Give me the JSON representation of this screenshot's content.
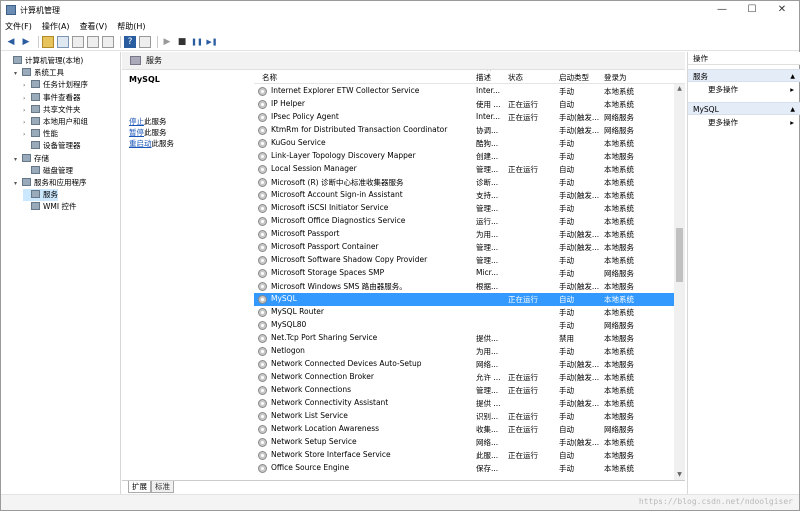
{
  "window": {
    "title": "计算机管理",
    "min": "—",
    "max": "☐",
    "close": "✕"
  },
  "menu": [
    "文件(F)",
    "操作(A)",
    "查看(V)",
    "帮助(H)"
  ],
  "toolbar": {
    "back": "◀",
    "fwd": "▶",
    "play": "▶",
    "stop": "■",
    "pause": "❚❚",
    "restart": "▶❚"
  },
  "tree": [
    {
      "label": "计算机管理(本地)",
      "level": 0,
      "arrow": "",
      "selected": false
    },
    {
      "label": "系统工具",
      "level": 1,
      "arrow": "▾",
      "selected": false
    },
    {
      "label": "任务计划程序",
      "level": 2,
      "arrow": "›",
      "selected": false
    },
    {
      "label": "事件查看器",
      "level": 2,
      "arrow": "›",
      "selected": false
    },
    {
      "label": "共享文件夹",
      "level": 2,
      "arrow": "›",
      "selected": false
    },
    {
      "label": "本地用户和组",
      "level": 2,
      "arrow": "›",
      "selected": false
    },
    {
      "label": "性能",
      "level": 2,
      "arrow": "›",
      "selected": false
    },
    {
      "label": "设备管理器",
      "level": 2,
      "arrow": "",
      "selected": false
    },
    {
      "label": "存储",
      "level": 1,
      "arrow": "▾",
      "selected": false
    },
    {
      "label": "磁盘管理",
      "level": 2,
      "arrow": "",
      "selected": false
    },
    {
      "label": "服务和应用程序",
      "level": 1,
      "arrow": "▾",
      "selected": false
    },
    {
      "label": "服务",
      "level": 2,
      "arrow": "",
      "selected": true
    },
    {
      "label": "WMI 控件",
      "level": 2,
      "arrow": "",
      "selected": false
    }
  ],
  "detail": {
    "header": "服务",
    "selected_service": "MySQL",
    "actions": [
      {
        "link": "停止",
        "rest": "此服务"
      },
      {
        "link": "暂停",
        "rest": "此服务"
      },
      {
        "link": "重启动",
        "rest": "此服务"
      }
    ]
  },
  "columns": [
    "名称",
    "描述",
    "状态",
    "启动类型",
    "登录为"
  ],
  "services": [
    [
      "Internet Explorer ETW Collector Service",
      "Inter...",
      "",
      "手动",
      "本地系统"
    ],
    [
      "IP Helper",
      "使用 ...",
      "正在运行",
      "自动",
      "本地系统"
    ],
    [
      "IPsec Policy Agent",
      "Inter...",
      "正在运行",
      "手动(触发...",
      "网络服务"
    ],
    [
      "KtmRm for Distributed Transaction Coordinator",
      "协调...",
      "",
      "手动(触发...",
      "网络服务"
    ],
    [
      "KuGou Service",
      "酷狗...",
      "",
      "手动",
      "本地系统"
    ],
    [
      "Link-Layer Topology Discovery Mapper",
      "创建...",
      "",
      "手动",
      "本地服务"
    ],
    [
      "Local Session Manager",
      "管理...",
      "正在运行",
      "自动",
      "本地系统"
    ],
    [
      "Microsoft (R) 诊断中心标准收集器服务",
      "诊断...",
      "",
      "手动",
      "本地系统"
    ],
    [
      "Microsoft Account Sign-in Assistant",
      "支持...",
      "",
      "手动(触发...",
      "本地系统"
    ],
    [
      "Microsoft iSCSI Initiator Service",
      "管理...",
      "",
      "手动",
      "本地系统"
    ],
    [
      "Microsoft Office Diagnostics Service",
      "运行...",
      "",
      "手动",
      "本地系统"
    ],
    [
      "Microsoft Passport",
      "为用...",
      "",
      "手动(触发...",
      "本地系统"
    ],
    [
      "Microsoft Passport Container",
      "管理...",
      "",
      "手动(触发...",
      "本地服务"
    ],
    [
      "Microsoft Software Shadow Copy Provider",
      "管理...",
      "",
      "手动",
      "本地系统"
    ],
    [
      "Microsoft Storage Spaces SMP",
      "Micr...",
      "",
      "手动",
      "网络服务"
    ],
    [
      "Microsoft Windows SMS 路由器服务。",
      "根据...",
      "",
      "手动(触发...",
      "本地服务"
    ],
    [
      "MySQL",
      "",
      "正在运行",
      "自动",
      "本地系统"
    ],
    [
      "MySQL Router",
      "",
      "",
      "手动",
      "本地系统"
    ],
    [
      "MySQL80",
      "",
      "",
      "手动",
      "网络服务"
    ],
    [
      "Net.Tcp Port Sharing Service",
      "提供...",
      "",
      "禁用",
      "本地服务"
    ],
    [
      "Netlogon",
      "为用...",
      "",
      "手动",
      "本地系统"
    ],
    [
      "Network Connected Devices Auto-Setup",
      "网络...",
      "",
      "手动(触发...",
      "本地服务"
    ],
    [
      "Network Connection Broker",
      "允许 ...",
      "正在运行",
      "手动(触发...",
      "本地系统"
    ],
    [
      "Network Connections",
      "管理...",
      "正在运行",
      "手动",
      "本地系统"
    ],
    [
      "Network Connectivity Assistant",
      "提供 ...",
      "",
      "手动(触发...",
      "本地系统"
    ],
    [
      "Network List Service",
      "识别...",
      "正在运行",
      "手动",
      "本地服务"
    ],
    [
      "Network Location Awareness",
      "收集...",
      "正在运行",
      "自动",
      "网络服务"
    ],
    [
      "Network Setup Service",
      "网络...",
      "",
      "手动(触发...",
      "本地系统"
    ],
    [
      "Network Store Interface Service",
      "此服...",
      "正在运行",
      "自动",
      "本地服务"
    ],
    [
      "Office  Source Engine",
      "保存...",
      "",
      "手动",
      "本地系统"
    ]
  ],
  "selected_index": 16,
  "tabs": {
    "extended": "扩展",
    "standard": "标准"
  },
  "actions_pane": {
    "title": "操作",
    "sections": [
      {
        "header": "服务",
        "items": [
          "更多操作"
        ]
      },
      {
        "header": "MySQL",
        "items": [
          "更多操作"
        ]
      }
    ],
    "chev": "▲",
    "more_arrow": "▸"
  },
  "watermark": "https://blog.csdn.net/ndoolgiser",
  "scroll": {
    "up": "▲",
    "down": "▼"
  },
  "sort_indicator": "^"
}
